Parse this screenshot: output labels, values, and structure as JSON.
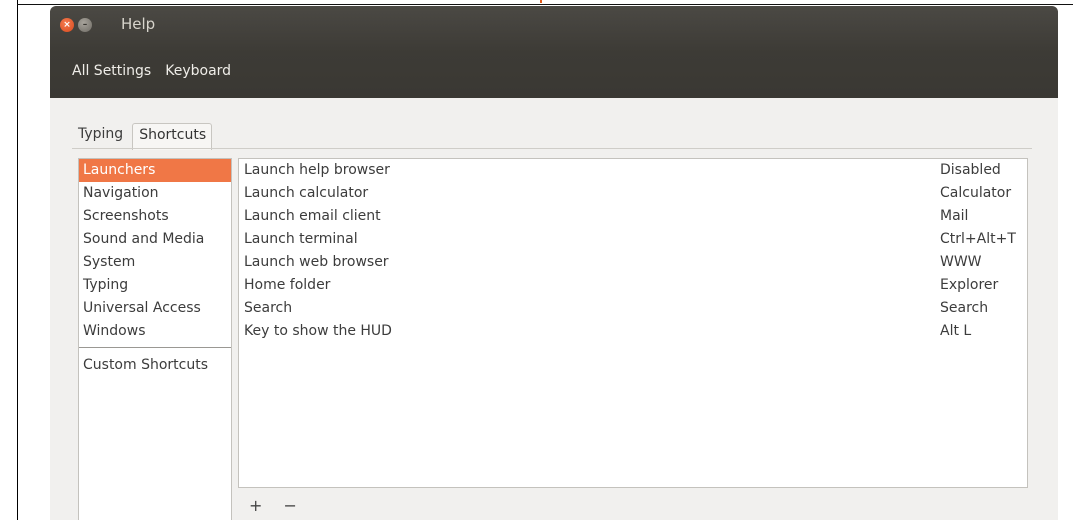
{
  "window": {
    "title": "Help",
    "close_glyph": "×",
    "minimize_glyph": "–"
  },
  "toolbar": {
    "all_settings": "All Settings",
    "keyboard": "Keyboard"
  },
  "tabs": [
    {
      "label": "Typing",
      "active": false
    },
    {
      "label": "Shortcuts",
      "active": true
    }
  ],
  "categories": [
    {
      "label": "Launchers",
      "selected": true
    },
    {
      "label": "Navigation",
      "selected": false
    },
    {
      "label": "Screenshots",
      "selected": false
    },
    {
      "label": "Sound and Media",
      "selected": false
    },
    {
      "label": "System",
      "selected": false
    },
    {
      "label": "Typing",
      "selected": false
    },
    {
      "label": "Universal Access",
      "selected": false
    },
    {
      "label": "Windows",
      "selected": false
    }
  ],
  "custom_shortcuts": "Custom Shortcuts",
  "shortcuts": [
    {
      "name": "Launch help browser",
      "accel": "Disabled"
    },
    {
      "name": "Launch calculator",
      "accel": "Calculator"
    },
    {
      "name": "Launch email client",
      "accel": "Mail"
    },
    {
      "name": "Launch terminal",
      "accel": "Ctrl+Alt+T"
    },
    {
      "name": "Launch web browser",
      "accel": "WWW"
    },
    {
      "name": "Home folder",
      "accel": "Explorer"
    },
    {
      "name": "Search",
      "accel": "Search"
    },
    {
      "name": "Key to show the HUD",
      "accel": "Alt L"
    }
  ],
  "actions": {
    "add": "+",
    "remove": "−"
  },
  "colors": {
    "selection": "#f07746",
    "titlebar": "#3d3b36"
  }
}
